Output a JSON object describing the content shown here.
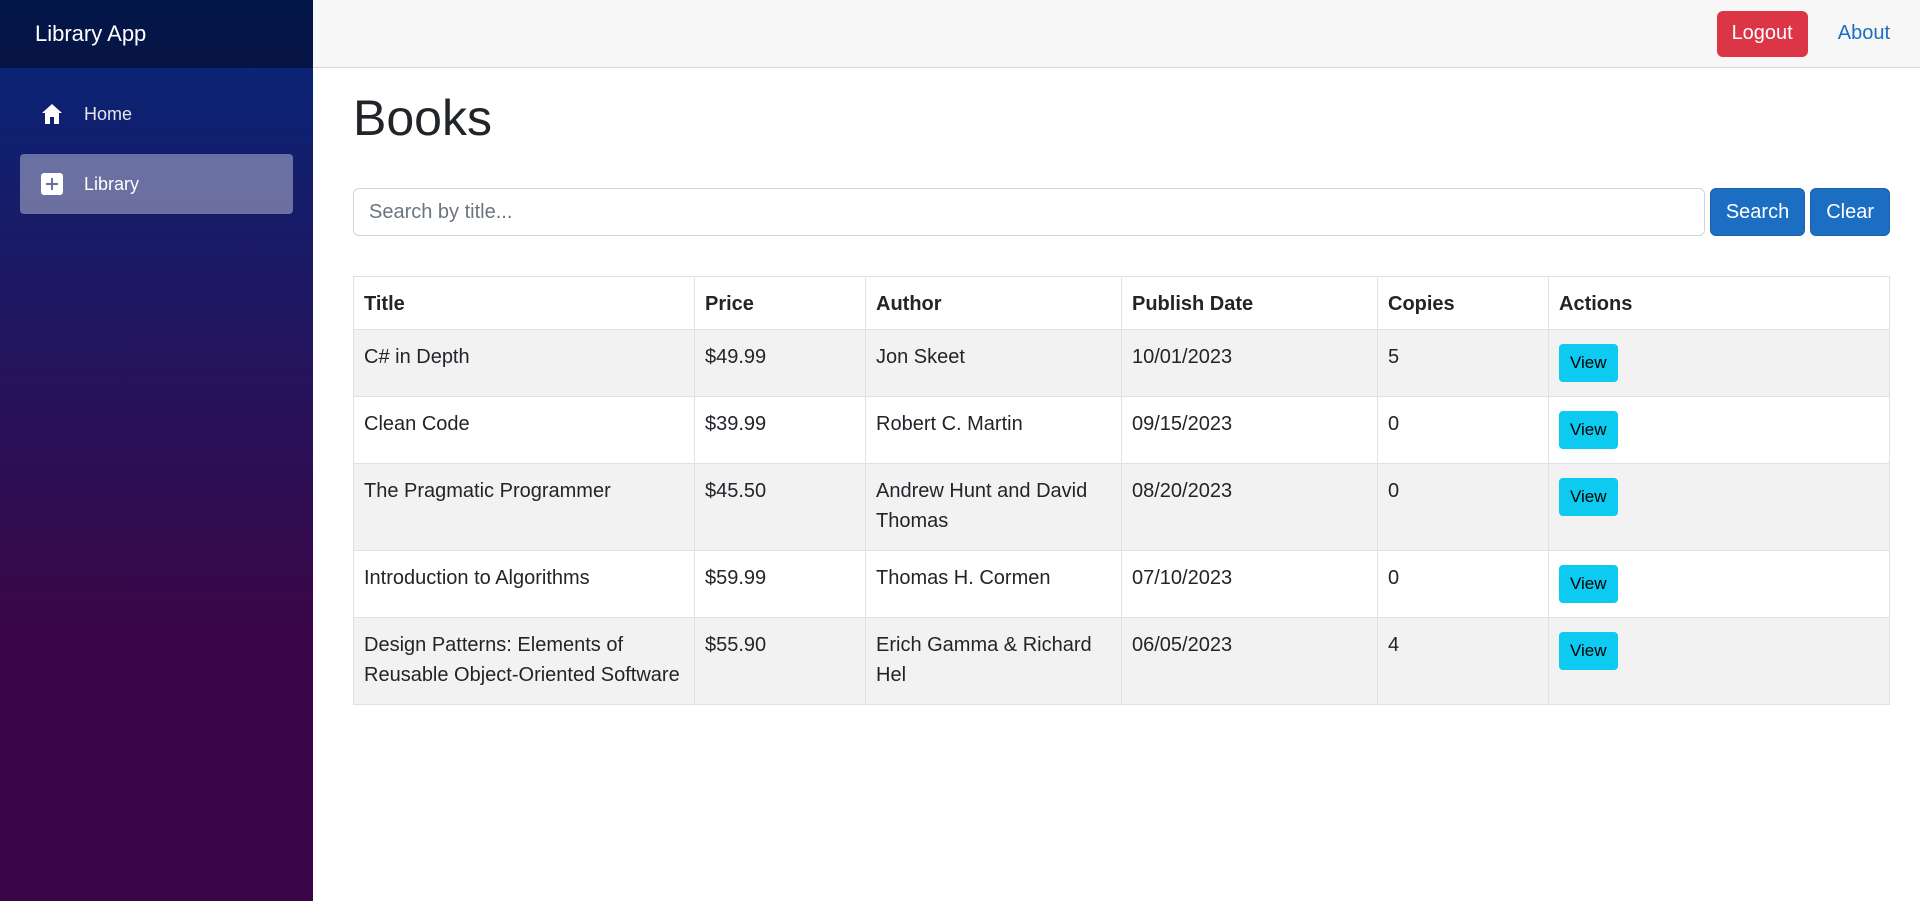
{
  "app": {
    "brand": "Library App"
  },
  "sidebar": {
    "items": [
      {
        "label": "Home",
        "icon": "home-icon",
        "active": false
      },
      {
        "label": "Library",
        "icon": "plus-square-icon",
        "active": true
      }
    ]
  },
  "topbar": {
    "logout_label": "Logout",
    "about_label": "About"
  },
  "page": {
    "title": "Books"
  },
  "search": {
    "placeholder": "Search by title...",
    "value": "",
    "search_label": "Search",
    "clear_label": "Clear"
  },
  "table": {
    "headers": [
      "Title",
      "Price",
      "Author",
      "Publish Date",
      "Copies",
      "Actions"
    ],
    "rows": [
      {
        "title": "C# in Depth",
        "price": "$49.99",
        "author": "Jon Skeet",
        "date": "10/01/2023",
        "copies": "5",
        "action": "View"
      },
      {
        "title": "Clean Code",
        "price": "$39.99",
        "author": "Robert C. Martin",
        "date": "09/15/2023",
        "copies": "0",
        "action": "View"
      },
      {
        "title": "The Pragmatic Programmer",
        "price": "$45.50",
        "author": "Andrew Hunt and David Thomas",
        "date": "08/20/2023",
        "copies": "0",
        "action": "View"
      },
      {
        "title": "Introduction to Algorithms",
        "price": "$59.99",
        "author": "Thomas H. Cormen",
        "date": "07/10/2023",
        "copies": "0",
        "action": "View"
      },
      {
        "title": "Design Patterns: Elements of Reusable Object-Oriented Software",
        "price": "$55.90",
        "author": "Erich Gamma & Richard Hel",
        "date": "06/05/2023",
        "copies": "4",
        "action": "View"
      }
    ]
  },
  "colors": {
    "logout": "#dc3545",
    "primary": "#1b6ec2",
    "view": "#0dcaf0"
  }
}
